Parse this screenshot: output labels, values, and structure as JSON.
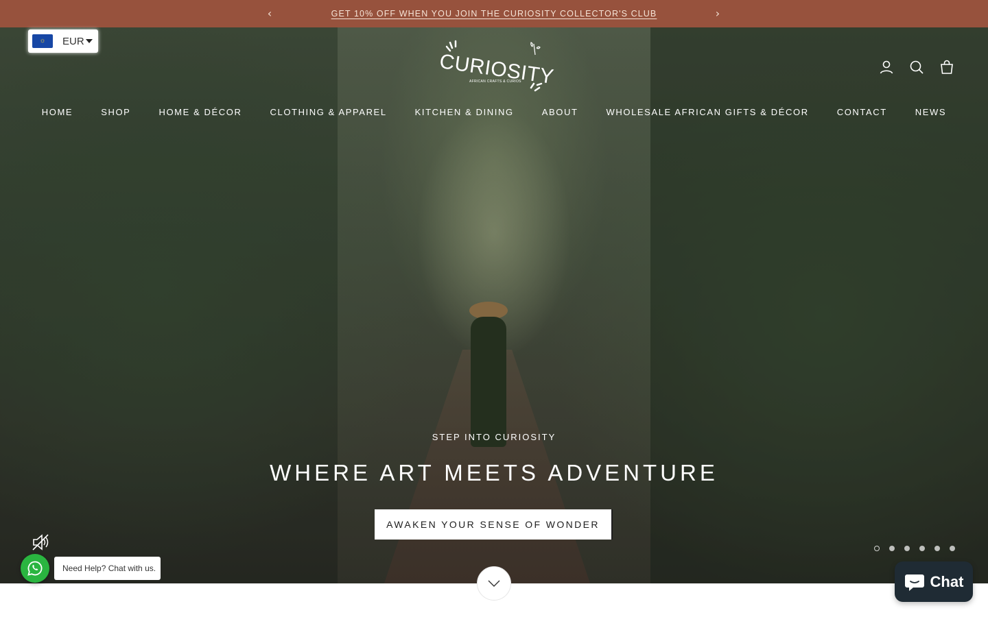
{
  "announcement": {
    "text": "GET 10% OFF WHEN YOU JOIN THE CURIOSITY COLLECTOR'S CLUB",
    "prev_icon": "chevron-left-icon",
    "next_icon": "chevron-right-icon"
  },
  "currency": {
    "code": "EUR",
    "flag_icon": "eu-flag-icon"
  },
  "logo": {
    "wordmark": "CURIOSITY",
    "tagline": "AFRICAN CRAFTS & CURIOS"
  },
  "header_icons": [
    "account-icon",
    "search-icon",
    "cart-icon"
  ],
  "nav": {
    "items": [
      "HOME",
      "SHOP",
      "HOME & DÉCOR",
      "CLOTHING & APPAREL",
      "KITCHEN & DINING",
      "ABOUT",
      "WHOLESALE AFRICAN GIFTS & DÉCOR",
      "CONTACT",
      "NEWS"
    ]
  },
  "hero": {
    "kicker": "STEP INTO CURIOSITY",
    "heading": "WHERE ART MEETS ADVENTURE",
    "cta": "AWAKEN YOUR SENSE OF WONDER",
    "slide_count": 6,
    "active_slide": 1
  },
  "whatsapp": {
    "label": "Need Help? Chat with us.",
    "icon": "whatsapp-icon"
  },
  "chat": {
    "label": "Chat",
    "icon": "chat-bubble-icon"
  },
  "colors": {
    "announcement_bg": "#97523d",
    "chat_bg": "#1f2b34",
    "whatsapp_green": "#2ab540"
  }
}
